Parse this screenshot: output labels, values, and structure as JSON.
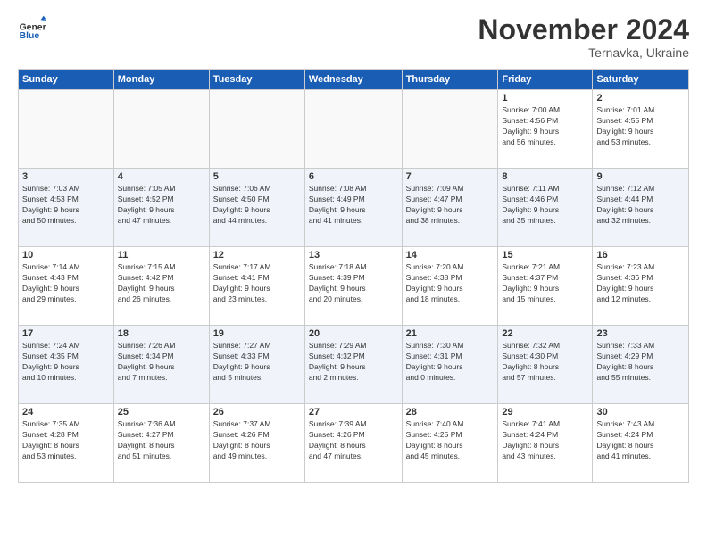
{
  "logo": {
    "general": "General",
    "blue": "Blue"
  },
  "title": "November 2024",
  "subtitle": "Ternavka, Ukraine",
  "weekdays": [
    "Sunday",
    "Monday",
    "Tuesday",
    "Wednesday",
    "Thursday",
    "Friday",
    "Saturday"
  ],
  "weeks": [
    [
      {
        "day": "",
        "info": ""
      },
      {
        "day": "",
        "info": ""
      },
      {
        "day": "",
        "info": ""
      },
      {
        "day": "",
        "info": ""
      },
      {
        "day": "",
        "info": ""
      },
      {
        "day": "1",
        "info": "Sunrise: 7:00 AM\nSunset: 4:56 PM\nDaylight: 9 hours\nand 56 minutes."
      },
      {
        "day": "2",
        "info": "Sunrise: 7:01 AM\nSunset: 4:55 PM\nDaylight: 9 hours\nand 53 minutes."
      }
    ],
    [
      {
        "day": "3",
        "info": "Sunrise: 7:03 AM\nSunset: 4:53 PM\nDaylight: 9 hours\nand 50 minutes."
      },
      {
        "day": "4",
        "info": "Sunrise: 7:05 AM\nSunset: 4:52 PM\nDaylight: 9 hours\nand 47 minutes."
      },
      {
        "day": "5",
        "info": "Sunrise: 7:06 AM\nSunset: 4:50 PM\nDaylight: 9 hours\nand 44 minutes."
      },
      {
        "day": "6",
        "info": "Sunrise: 7:08 AM\nSunset: 4:49 PM\nDaylight: 9 hours\nand 41 minutes."
      },
      {
        "day": "7",
        "info": "Sunrise: 7:09 AM\nSunset: 4:47 PM\nDaylight: 9 hours\nand 38 minutes."
      },
      {
        "day": "8",
        "info": "Sunrise: 7:11 AM\nSunset: 4:46 PM\nDaylight: 9 hours\nand 35 minutes."
      },
      {
        "day": "9",
        "info": "Sunrise: 7:12 AM\nSunset: 4:44 PM\nDaylight: 9 hours\nand 32 minutes."
      }
    ],
    [
      {
        "day": "10",
        "info": "Sunrise: 7:14 AM\nSunset: 4:43 PM\nDaylight: 9 hours\nand 29 minutes."
      },
      {
        "day": "11",
        "info": "Sunrise: 7:15 AM\nSunset: 4:42 PM\nDaylight: 9 hours\nand 26 minutes."
      },
      {
        "day": "12",
        "info": "Sunrise: 7:17 AM\nSunset: 4:41 PM\nDaylight: 9 hours\nand 23 minutes."
      },
      {
        "day": "13",
        "info": "Sunrise: 7:18 AM\nSunset: 4:39 PM\nDaylight: 9 hours\nand 20 minutes."
      },
      {
        "day": "14",
        "info": "Sunrise: 7:20 AM\nSunset: 4:38 PM\nDaylight: 9 hours\nand 18 minutes."
      },
      {
        "day": "15",
        "info": "Sunrise: 7:21 AM\nSunset: 4:37 PM\nDaylight: 9 hours\nand 15 minutes."
      },
      {
        "day": "16",
        "info": "Sunrise: 7:23 AM\nSunset: 4:36 PM\nDaylight: 9 hours\nand 12 minutes."
      }
    ],
    [
      {
        "day": "17",
        "info": "Sunrise: 7:24 AM\nSunset: 4:35 PM\nDaylight: 9 hours\nand 10 minutes."
      },
      {
        "day": "18",
        "info": "Sunrise: 7:26 AM\nSunset: 4:34 PM\nDaylight: 9 hours\nand 7 minutes."
      },
      {
        "day": "19",
        "info": "Sunrise: 7:27 AM\nSunset: 4:33 PM\nDaylight: 9 hours\nand 5 minutes."
      },
      {
        "day": "20",
        "info": "Sunrise: 7:29 AM\nSunset: 4:32 PM\nDaylight: 9 hours\nand 2 minutes."
      },
      {
        "day": "21",
        "info": "Sunrise: 7:30 AM\nSunset: 4:31 PM\nDaylight: 9 hours\nand 0 minutes."
      },
      {
        "day": "22",
        "info": "Sunrise: 7:32 AM\nSunset: 4:30 PM\nDaylight: 8 hours\nand 57 minutes."
      },
      {
        "day": "23",
        "info": "Sunrise: 7:33 AM\nSunset: 4:29 PM\nDaylight: 8 hours\nand 55 minutes."
      }
    ],
    [
      {
        "day": "24",
        "info": "Sunrise: 7:35 AM\nSunset: 4:28 PM\nDaylight: 8 hours\nand 53 minutes."
      },
      {
        "day": "25",
        "info": "Sunrise: 7:36 AM\nSunset: 4:27 PM\nDaylight: 8 hours\nand 51 minutes."
      },
      {
        "day": "26",
        "info": "Sunrise: 7:37 AM\nSunset: 4:26 PM\nDaylight: 8 hours\nand 49 minutes."
      },
      {
        "day": "27",
        "info": "Sunrise: 7:39 AM\nSunset: 4:26 PM\nDaylight: 8 hours\nand 47 minutes."
      },
      {
        "day": "28",
        "info": "Sunrise: 7:40 AM\nSunset: 4:25 PM\nDaylight: 8 hours\nand 45 minutes."
      },
      {
        "day": "29",
        "info": "Sunrise: 7:41 AM\nSunset: 4:24 PM\nDaylight: 8 hours\nand 43 minutes."
      },
      {
        "day": "30",
        "info": "Sunrise: 7:43 AM\nSunset: 4:24 PM\nDaylight: 8 hours\nand 41 minutes."
      }
    ]
  ]
}
